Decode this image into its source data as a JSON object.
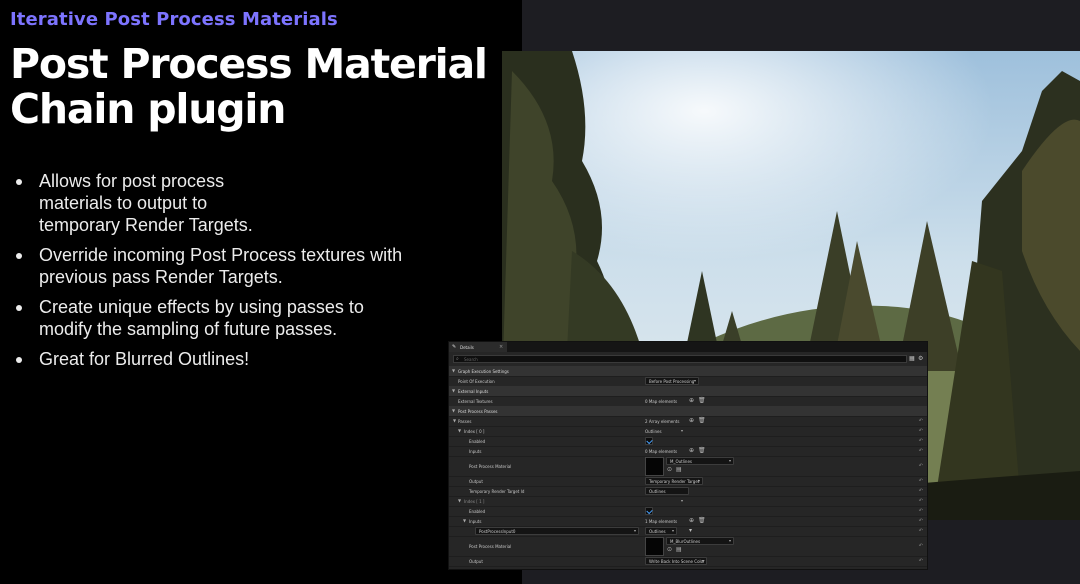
{
  "slide": {
    "kicker": "Iterative Post Process Materials",
    "title_line1": "Post Process Material",
    "title_line2": "Chain plugin",
    "bullets": [
      "Allows for post process materials to output to temporary Render Targets.",
      "Override incoming Post Process textures with previous pass Render Targets.",
      "Create unique effects by using passes to modify the sampling of future passes.",
      "Great for Blurred Outlines!"
    ]
  },
  "colors": {
    "accent": "#7d74ff",
    "panel_bg": "#262626",
    "category_bg": "#333333",
    "check_blue": "#4aa3ff"
  },
  "viewport": {
    "description_icon": "forest-scene"
  },
  "details": {
    "tab_label": "Details",
    "search_placeholder": "Search",
    "rows": {
      "graph_settings": "Graph Execution Settings",
      "point_of_execution": "Point Of Execution",
      "point_of_execution_value": "Before Post Processing",
      "external_inputs": "External Inputs",
      "external_textures": "External Textures",
      "external_textures_value": "0 Map elements",
      "pp_passes": "Post Process Passes",
      "passes": "Passes",
      "passes_value": "2 Array elements",
      "index0": "Index [ 0 ]",
      "index0_value": "Outlines",
      "enabled0": "Enabled",
      "inputs0": "Inputs",
      "inputs0_value": "0 Map elements",
      "ppm0": "Post Process Material",
      "ppm0_value": "M_Outlines",
      "output0": "Output",
      "output0_value": "Temporary Render Target",
      "temp_rt_id": "Temporary Render Target Id",
      "temp_rt_id_value": "Outlines",
      "index1": "Index [ 1 ]",
      "enabled1": "Enabled",
      "inputs1": "Inputs",
      "inputs1_value": "1 Map elements",
      "input_key": "PostProcessInput0",
      "input_val": "Outlines",
      "ppm1": "Post Process Material",
      "ppm1_value": "M_BlurOutlines",
      "output1": "Output",
      "output1_value": "Write Back Into Scene Color"
    }
  }
}
